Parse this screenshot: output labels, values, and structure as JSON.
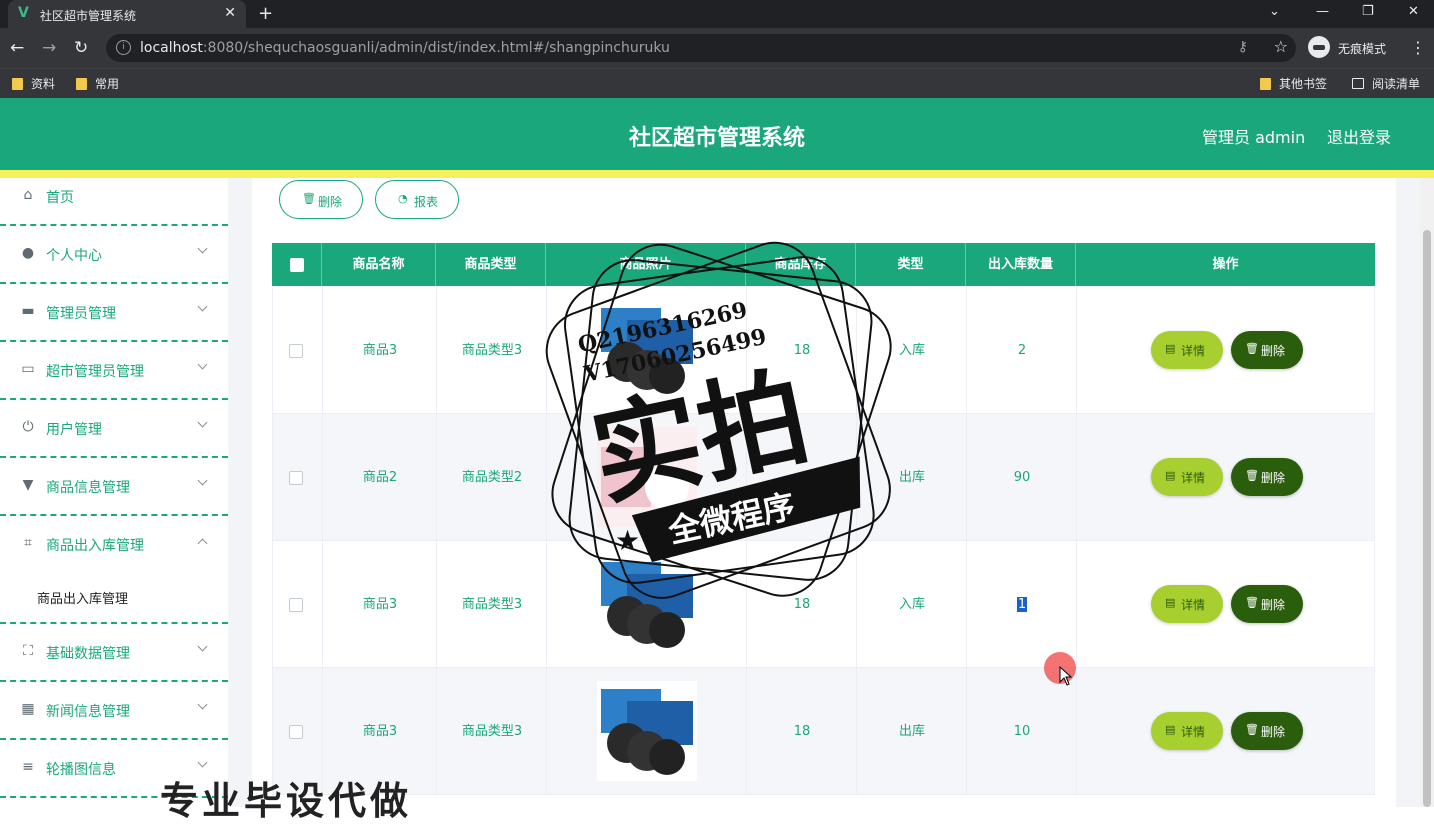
{
  "browser": {
    "tab_title": "社区超市管理系统",
    "url_host": "localhost",
    "url_rest": ":8080/shequchaosguanli/admin/dist/index.html#/shangpinchuruku",
    "incognito_label": "无痕模式",
    "bookmarks": [
      "资料",
      "常用"
    ],
    "bookmarks_right": [
      "其他书签",
      "阅读清单"
    ]
  },
  "header": {
    "title": "社区超市管理系统",
    "user": "管理员 admin",
    "logout": "退出登录"
  },
  "sidebar": {
    "items": [
      {
        "label": "首页",
        "icon": "home-icon"
      },
      {
        "label": "个人中心",
        "icon": "user-icon"
      },
      {
        "label": "管理员管理",
        "icon": "monitor-icon"
      },
      {
        "label": "超市管理员管理",
        "icon": "id-card-icon"
      },
      {
        "label": "用户管理",
        "icon": "power-icon"
      },
      {
        "label": "商品信息管理",
        "icon": "paint-roller-icon"
      },
      {
        "label": "商品出入库管理",
        "icon": "crop-icon"
      },
      {
        "label": "基础数据管理",
        "icon": "full-screen-icon"
      },
      {
        "label": "新闻信息管理",
        "icon": "grid-icon"
      },
      {
        "label": "轮播图信息",
        "icon": "list-icon"
      }
    ],
    "submenu": {
      "label": "商品出入库管理"
    }
  },
  "toolbar": {
    "delete_label": "删除",
    "report_label": "报表"
  },
  "table": {
    "headers": [
      "商品名称",
      "商品类型",
      "商品照片",
      "商品库存",
      "类型",
      "出入库数量",
      "操作"
    ],
    "rows": [
      {
        "name": "商品3",
        "type": "商品类型3",
        "stock": "18",
        "kind": "入库",
        "qty": "2"
      },
      {
        "name": "商品2",
        "type": "商品类型2",
        "stock": "",
        "kind": "出库",
        "qty": "90"
      },
      {
        "name": "商品3",
        "type": "商品类型3",
        "stock": "18",
        "kind": "入库",
        "qty": "1"
      },
      {
        "name": "商品3",
        "type": "商品类型3",
        "stock": "18",
        "kind": "出库",
        "qty": "10"
      }
    ],
    "detail_label": "详情",
    "delete_label": "删除"
  },
  "watermark": {
    "line1": "Q2196316269",
    "line2": "V17060256499",
    "big": "实拍",
    "banner": "全微程序",
    "bottom": "专业毕设代做"
  },
  "colors": {
    "brand": "#1aa77b",
    "accent_yellow": "#f5f15a",
    "detail_btn": "#a6cf2f",
    "delete_btn": "#2a5e0c"
  }
}
